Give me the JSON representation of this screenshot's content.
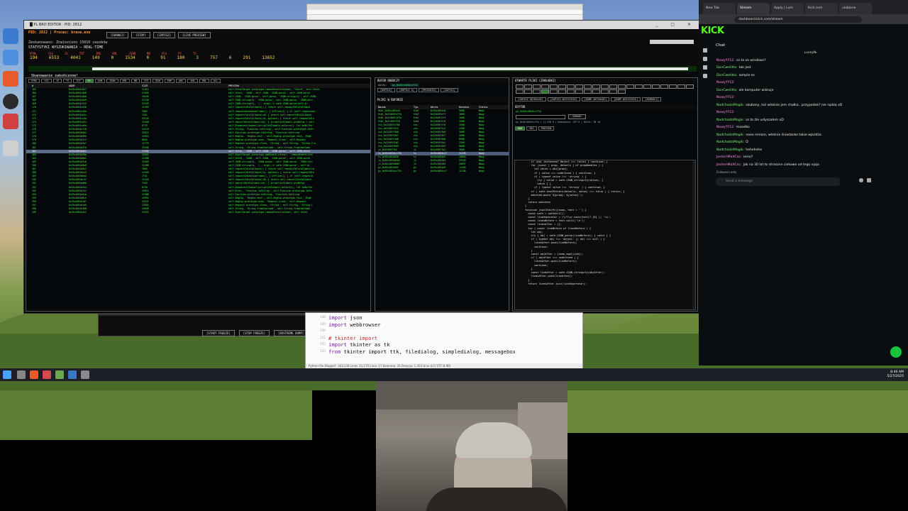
{
  "scanner": {
    "title": "█ PL BRO EDITOR · PID: 2812",
    "pid_line": "PID: 2812   |   Proces: brave.exe",
    "found_line": "Zeskanowano: Znaleziono 15010 zasobów",
    "stats_title": "STATYSTYKI WYSZUKIWANIA – REAL-TIME",
    "toolbar": [
      "[SKANUJ]",
      "[STOP]",
      "[ZAPISZ]",
      "[LIVE PREVIEW]"
    ],
    "counter_labels": [
      "HTML",
      "CSS",
      "JS",
      "TXT",
      "IMG",
      "XML",
      "JSON",
      "MD",
      "CFG",
      "PY",
      "TS"
    ],
    "counter_values": [
      "194",
      "6553",
      "4041",
      "149",
      "0",
      "1534",
      "0",
      "91",
      "180",
      "3",
      "757",
      "6",
      "291",
      "13652"
    ],
    "scan_status": "Skanowanie zakończone!",
    "filters": [
      "HTML",
      "CSS",
      "JS",
      "TS",
      "TXT",
      "PY",
      "ASM",
      "JSON",
      "XML",
      "MD",
      "CFG",
      "BIN",
      "PHP",
      "ARC",
      "INI",
      "URL",
      "ALL"
    ],
    "grid_headers": [
      "#",
      "ADDR",
      "SIZE",
      "PREVIEW"
    ],
    "rows": [
      [
        "165",
        "0x55c4054c827",
        "11411",
        "self.fetchTarget.prototype.removeEventListener, \"fetch\", self.fetch"
      ],
      [
        "166",
        "0x55c4054c868",
        "22594",
        "self.fetch, 'JSON', self.JSON, 'JSON.parse', self.JSON.parse"
      ],
      [
        "167",
        "0x55c4054c8b0",
        "19236",
        "self.JSON, 'JSON.parse', self.parse, 'JSON.stringify', self.JSON"
      ],
      [
        "168",
        "0x55c4054c8e9",
        "21228",
        "self.JSON.stringify, 'JSON.parse', self.JSON.parse, 'JSON.pars"
      ],
      [
        "169",
        "0x55c4054c914",
        "21149",
        "self.JSON.stringify, '(...args) => safe.JSON.parse(self.ar"
      ],
      [
        "170",
        "0x55c4054ca38",
        "11349",
        "self.requestIdleCallback() { return self.requestIdleCallback"
      ],
      [
        "171",
        "0x55c4054ca5e",
        "7865",
        "self.requestAnimationFrame(), } offline(1) { if (self.requestAni"
      ],
      [
        "172",
        "0x55c4054cb2c",
        "7451",
        "self.requestIdleCallback(id) { return self.cancelIdleCallback"
      ],
      [
        "173",
        "0x55c4054cc6a",
        "23149",
        "self.requestIdleCallback(id, options) { return self.requestIdle"
      ],
      [
        "174",
        "0x55c4054cd21",
        "11458",
        "self.cancelIdleCallback(id); } scriptletGlobals.preDelay = self"
      ],
      [
        "175",
        "0x55c4054ce6d",
        "6733",
        "self.BroadcastChannel(scriptletGlobals.bcSecret); let bcBuffer"
      ],
      [
        "176",
        "0x55c4054cf18",
        "24119",
        "self.String, 'Function.toString', self.Function.prototype.toStr"
      ],
      [
        "177",
        "0x55c4054d002",
        "13512",
        "self.Function.prototype.toString, 'Function.toString'"
      ],
      [
        "178",
        "0x55c4054d09e",
        "11023",
        "self.RegExp, 'RegExp.test', self.RegExp.prototype.test, 'RegE"
      ],
      [
        "179",
        "0x55c4054d1c3",
        "8845",
        "self.RegExp.prototype.exec, 'Request_clone', self.Request"
      ],
      [
        "180",
        "0x55c4054d2a7",
        "11779",
        "self.Request.prototype.clone, 'String', self.String, 'String.fro"
      ],
      [
        "181",
        "0x55c4054d3f0",
        "23165",
        "self.String, 'String.fromCharCode', self.String.fromCharCode"
      ],
      [
        "182",
        "0x55c4054d4e1",
        "17491",
        "self.fetch, 'JSON', self.JSON, 'JSON.parse', self.JSON.parse"
      ],
      [
        "183",
        "0x55c4054d58a",
        "15361",
        "self.EventTarget.prototype.addEventListener, 'removeEventListe"
      ],
      [
        "184",
        "0x55c4054d6b2",
        "11208",
        "self.fetch, 'JSON', self.JSON, 'JSON.parse', self.JSON.parse"
      ],
      [
        "185",
        "0x55c4054d7c8",
        "11269",
        "self.JSON.stringify, 'JSON.parse', self.JSON.parse, 'JSON.stri"
      ],
      [
        "186",
        "0x55c4054d8a0",
        "11288",
        "self.JSON.stringify, '(...args) => safe.JSON.parse', self.ar"
      ],
      [
        "187",
        "0x55c4054d9e1",
        "7865",
        "self.requestIdleCallback() { return self.requestIdleCallback(id"
      ],
      [
        "188",
        "0x55c4054da13",
        "11549",
        "self.requestIdleCallback(id, options) { return self.requestIdle"
      ],
      [
        "189",
        "0x55c4054dba2",
        "7741",
        "self.requestAnimationFrame(), } offline(1) { if (self.requestA"
      ],
      [
        "190",
        "0x55c4054dc5f",
        "11549",
        "self.requestIdleCallback(id) { return self.cancelIdleCallback"
      ],
      [
        "191",
        "0x55c4054dd0b",
        "7459",
        "self.cancelIdleCallback(id); } scriptletGlobals.preDelay"
      ],
      [
        "192",
        "0x55c4054de44",
        "8736",
        "self.BroadcastChannel(scriptletGlobals.bcSecret); let bcBuffer"
      ],
      [
        "193",
        "0x55c4054df31",
        "15911",
        "self.Error, 'Function.toString', self.Function.prototype.toStr"
      ],
      [
        "194",
        "0x55c4054e01a",
        "11908",
        "self.Function.prototype.toString, 'Function.toString'"
      ],
      [
        "195",
        "0x55c4054e0c5",
        "19932",
        "self.RegExp, 'RegExp.test', self.RegExp.prototype.test, 'RegE"
      ],
      [
        "196",
        "0x55c4054e1d7",
        "12131",
        "self.RegExp.prototype.exec, 'Request_clone', self.Request"
      ],
      [
        "197",
        "0x55c4054e2a9",
        "13981",
        "self.Request.prototype.clone, 'String', self.String, 'String.f"
      ],
      [
        "198",
        "0x55c4054e3b8",
        "15948",
        "self.String, 'String.fromCharCode', self.String.fromCharCode"
      ],
      [
        "199",
        "0x55c4054e4c2",
        "19432",
        "self.EventTarget.prototype.removeEventListener, self.fetch"
      ]
    ],
    "selected_row": 17,
    "buffer_title": "BUFOR ROBOCZY",
    "buffer_addr_label": "Adres:",
    "buffer_addr": "py_0x55c4054cc734",
    "buffer_buttons": [
      "[KOPIUJ]",
      "[KOPIUJ A]",
      "[PRZENIEŚ]",
      "[ZAPISZ]"
    ],
    "files_title": "PLIKI W BUFORZE",
    "file_headers": [
      "Nazwa",
      "Typ",
      "Adres",
      "Rozmiar",
      "Status"
    ],
    "files": [
      [
        "html_0x55c4054c8",
        "html",
        "0x55c4054c8",
        "5006",
        "Nowy"
      ],
      [
        "html_0x22465fe7f0",
        "html",
        "0x22465fe7f",
        "3006",
        "Nowy"
      ],
      [
        "html_0x22465f1f3a",
        "html",
        "0x22465f1f3",
        "1008",
        "Nowy"
      ],
      [
        "html_0x22465f3f0",
        "html",
        "0x22465f3f0",
        "2008",
        "Nowy"
      ],
      [
        "css_0x22465f1f04",
        "css",
        "0x22465f1f0",
        "1500",
        "Nowy"
      ],
      [
        "css_0x22465f2c2",
        "css",
        "0x22465f2c2",
        "2400",
        "Nowy"
      ],
      [
        "css_0x22465f3a0",
        "css",
        "0x22465f3a0",
        "3406",
        "Nowy"
      ],
      [
        "css_0x22465f3e7",
        "css",
        "0x22465f3e7",
        "1008",
        "Nowy"
      ],
      [
        "css_0x22465f4b0",
        "css",
        "0x22465f4b0",
        "6008",
        "Nowy"
      ],
      [
        "css_0x22465f5d1",
        "css",
        "0x22465f5d1",
        "2200",
        "Nowy"
      ],
      [
        "css_0x22465f6e9",
        "css",
        "0x22465f6e9",
        "9008",
        "Nowy"
      ],
      [
        "js_0x22465f7a2",
        "js",
        "0x22465f7a2",
        "3008",
        "Nowy"
      ],
      [
        "ts_0x55c4054cc734",
        "ts",
        "0x55c4054cc7",
        "11238",
        "Nowy"
      ],
      [
        "ts_0x55c4054d20",
        "ts",
        "0x55c4054d2",
        "10818",
        "Nowy"
      ],
      [
        "js_0x55c4054d4a2",
        "js",
        "0x55c4054d4",
        "23149",
        "Nowy"
      ],
      [
        "js_0x55c4054d6e7",
        "js",
        "0x55c4054d6",
        "20637",
        "Nowy"
      ],
      [
        "py_0x55c4054d9f",
        "py",
        "0x55c4054d9",
        "11349",
        "Nowy"
      ],
      [
        "py_0x55c4054cc734",
        "py",
        "0x55c4054cc7",
        "11238",
        "Nowy"
      ]
    ],
    "selected_file": 12,
    "opened_title": "OTWARTE PLIKI (ZAKŁADKI)",
    "opened_buttons": [
      "[ZAPISZ AKTUALNY]",
      "[ZAPISZ WSZYSTKIE]",
      "[DUMP AKTUALNY]",
      "[DUMP WSZYSTKIE]",
      "[ZAMKNIJ]"
    ],
    "editor_title": "EDYTOR",
    "editor_addr": "py_0x55c4054cc734",
    "editor_search": "SZUKAJ",
    "editor_tabs": [
      "KOD",
      "HEX",
      "PREVIEW"
    ],
    "editor_status": "py_0x55c4054cc734 | 11,238 B | Kodowanie: UTF-8 | Bufor: IN 10",
    "code_lines": [
      "    if (obj instanceof Object === false) { continue; }",
      "    for (const [ prop, details ] of propNeedles ) {",
      "      let value = obj[prop];",
      "      if ( value === undefined ) { continue; }",
      "      if ( typeof value !== 'string' ) {",
      "        try { value = safe.JSON_stringify(value); }",
      "        catch { }",
      "      if ( typeof value !== 'string' ) { continue; }",
      "",
      "    if ( safe.testPattern(details, value) === false ) { return; }",
      "    matched.push(`${prop}: ${value}`);",
      "  }",
      "  return matched;",
      "}",
      "",
      "function jsonlEditFn(jsonp, text = '') {",
      "  const safe = safeSelf();",
      "  const lineSeparator = /\\r?\\n/.exec(text)?.[0] || '\\n';",
      "  const linesBefore = text.split('\\n');",
      "  const linesAfter = [];",
      "  for ( const lineBefore of linesBefore ) {",
      "    let obj;",
      "    try { obj = safe.JSON_parse(lineBefore); } catch { }",
      "    if ( typeof obj !== 'object' || obj === null ) {",
      "      linesAfter.push(lineBefore);",
      "      continue;",
      "    }",
      "    const objAfter = jsonp.apply(obj);",
      "    if ( objAfter === undefined ) {",
      "      linesAfter.push(lineBefore);",
      "      continue;",
      "    }",
      "    const lineAfter = safe.JSON_stringify(objAfter);",
      "    linesAfter.push(lineAfter);",
      "  }",
      "  return linesAfter.join(lineSeparator);"
    ]
  },
  "bottom_buttons": [
    "[START FREEZE]",
    "[STOP FREEZE]",
    "[EKSTREME DUMP]"
  ],
  "python_editor": {
    "line_numbers": [
      "148",
      "149",
      "150",
      "151",
      "152",
      "153"
    ],
    "lines": [
      {
        "kw": "import",
        "rest": " json"
      },
      {
        "kw": "import",
        "rest": " webbrowser"
      },
      {
        "kw": "",
        "rest": ""
      },
      {
        "kw": "# tkinter import",
        "rest": "",
        "comment": true
      },
      {
        "kw": "import",
        "rest": " tkinter as tk"
      },
      {
        "kw": "from",
        "rest": " tkinter import ttk, filedialog, simpledialog, messagebox"
      }
    ],
    "status": "Python file   Długość: 343,134   Linie: 15,170   Linia: 17   Kolumna: 31   Pozycja: 1,453   Unix (LF)   UTF-8   INS"
  },
  "kick": {
    "tabs": [
      "New Tab",
      "Stream",
      "Apply | Lum",
      "Kick.com",
      "ulubione"
    ],
    "url": "dashboard.kick.com/stream",
    "logo": "KICK",
    "chat_title": "Chat",
    "top_user": "Lucky№",
    "messages": [
      {
        "user": "NowyYY12:",
        "text": "co to za windows?",
        "c": "p"
      },
      {
        "user": "DonCwelitto:",
        "text": "tak jest",
        "c": "g"
      },
      {
        "user": "DonCwelitto:",
        "text": "lampie es",
        "c": "g"
      },
      {
        "user": "NowyYY12:",
        "text": "",
        "c": "p"
      },
      {
        "user": "DonCwelitto:",
        "text": "ale komputer wibruje",
        "c": "g"
      },
      {
        "user": "NowyYY12:",
        "text": "",
        "c": "p"
      },
      {
        "user": "NadchodziMagik:",
        "text": "skubany, też właśnie jem chałka.. przypadek? nie sądzę xD",
        "c": "g"
      },
      {
        "user": "NowyYY12:",
        "text": "",
        "c": "p"
      },
      {
        "user": "NadchodziMagik:",
        "text": "ss to źle usłyszałem xD",
        "c": "g"
      },
      {
        "user": "NowyYY12:",
        "text": "masełko",
        "c": "p"
      },
      {
        "user": "NadchodziMagik:",
        "text": "nooo mniam, właśnie śniadanko takie wjeżdża",
        "c": "g"
      },
      {
        "user": "NadchodziMagik:",
        "text": "D",
        "c": "g"
      },
      {
        "user": "NadchodziMagik:",
        "text": "hehehehe",
        "c": "g"
      },
      {
        "user": "JestemMaltCoc:",
        "text": "serio?",
        "c": "p"
      },
      {
        "user": "JestemMaltCoc:",
        "text": "Jak na 30 lat to straszne ciekawe od tego ejaja",
        "c": "p"
      }
    ],
    "followers_only": "Followers only",
    "chat_placeholder": "Send a message"
  },
  "taskbar": {
    "time": "8:40 AM",
    "date": "5/27/2025"
  }
}
